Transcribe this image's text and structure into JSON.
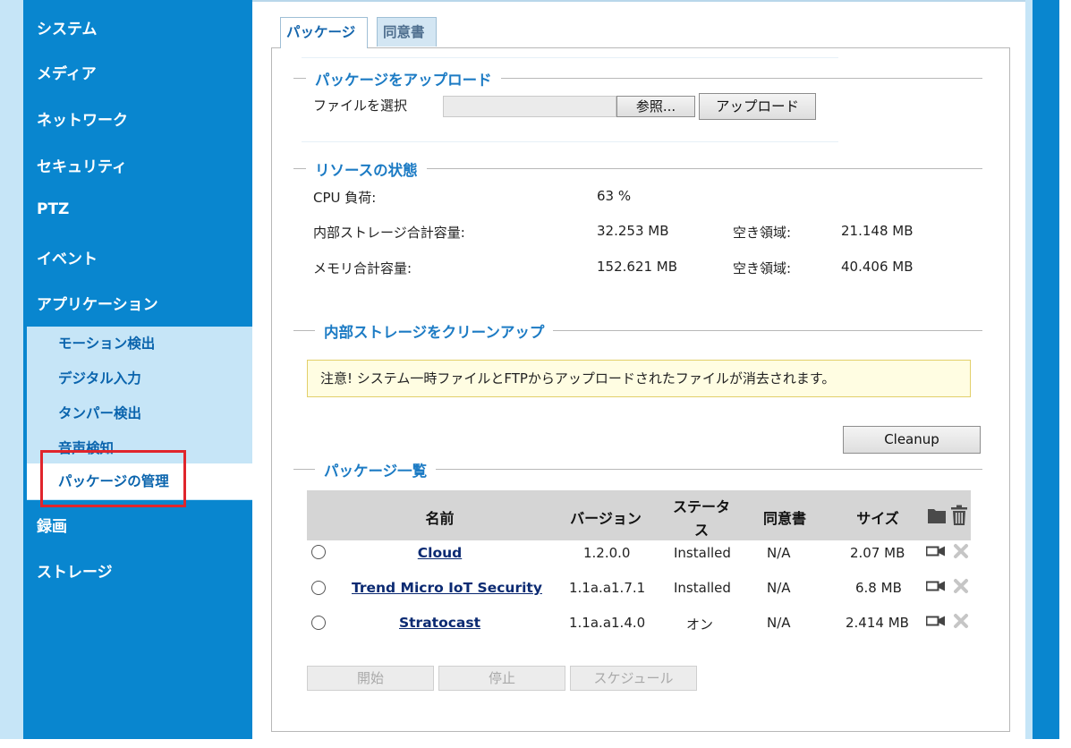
{
  "sidebar": {
    "items": [
      "システム",
      "メディア",
      "ネットワーク",
      "セキュリティ",
      "PTZ",
      "イベント",
      "アプリケーション"
    ],
    "sub_items": [
      "モーション検出",
      "デジタル入力",
      "タンパー検出",
      "音声検知",
      "パッケージの管理"
    ],
    "items_after": [
      "録画",
      "ストレージ"
    ],
    "active_sub_item": "パッケージの管理"
  },
  "tabs": {
    "package": "パッケージ",
    "agreement": "同意書",
    "active": "パッケージ"
  },
  "upload": {
    "title": "パッケージをアップロード",
    "file_label": "ファイルを選択",
    "browse_button": "参照...",
    "upload_button": "アップロード"
  },
  "resources": {
    "title": "リソースの状態",
    "cpu_label": "CPU 負荷:",
    "cpu_value": "63 %",
    "storage_label": "内部ストレージ合計容量:",
    "storage_value": "32.253 MB",
    "storage_free_label": "空き領域:",
    "storage_free_value": "21.148 MB",
    "memory_label": "メモリ合計容量:",
    "memory_value": "152.621 MB",
    "memory_free_label": "空き領域:",
    "memory_free_value": "40.406 MB"
  },
  "cleanup": {
    "title": "内部ストレージをクリーンアップ",
    "notice": "注意! システム一時ファイルとFTPからアップロードされたファイルが消去されます。",
    "button": "Cleanup"
  },
  "packages": {
    "title": "パッケージ一覧",
    "headers": {
      "name": "名前",
      "version": "バージョン",
      "status_line1": "ステータ",
      "status_line2": "ス",
      "agreement": "同意書",
      "size": "サイズ"
    },
    "rows": [
      {
        "name": "Cloud",
        "version": "1.2.0.0",
        "status": "Installed",
        "agreement": "N/A",
        "size": "2.07 MB"
      },
      {
        "name": "Trend Micro IoT Security",
        "version": "1.1a.a1.7.1",
        "status": "Installed",
        "agreement": "N/A",
        "size": "6.8 MB"
      },
      {
        "name": "Stratocast",
        "version": "1.1a.a1.4.0",
        "status": "オン",
        "agreement": "N/A",
        "size": "2.414 MB"
      }
    ],
    "buttons": {
      "start": "開始",
      "stop": "停止",
      "schedule": "スケジュール"
    }
  },
  "colors": {
    "sidebar_bg": "#0986cf",
    "subnav_bg": "#c6e5f7",
    "section_title": "#1c7bc4",
    "highlight_border": "#e0252c",
    "link": "#0b2a72"
  },
  "icons": [
    "folder-icon",
    "trash-icon",
    "camera-icon",
    "close-icon"
  ]
}
